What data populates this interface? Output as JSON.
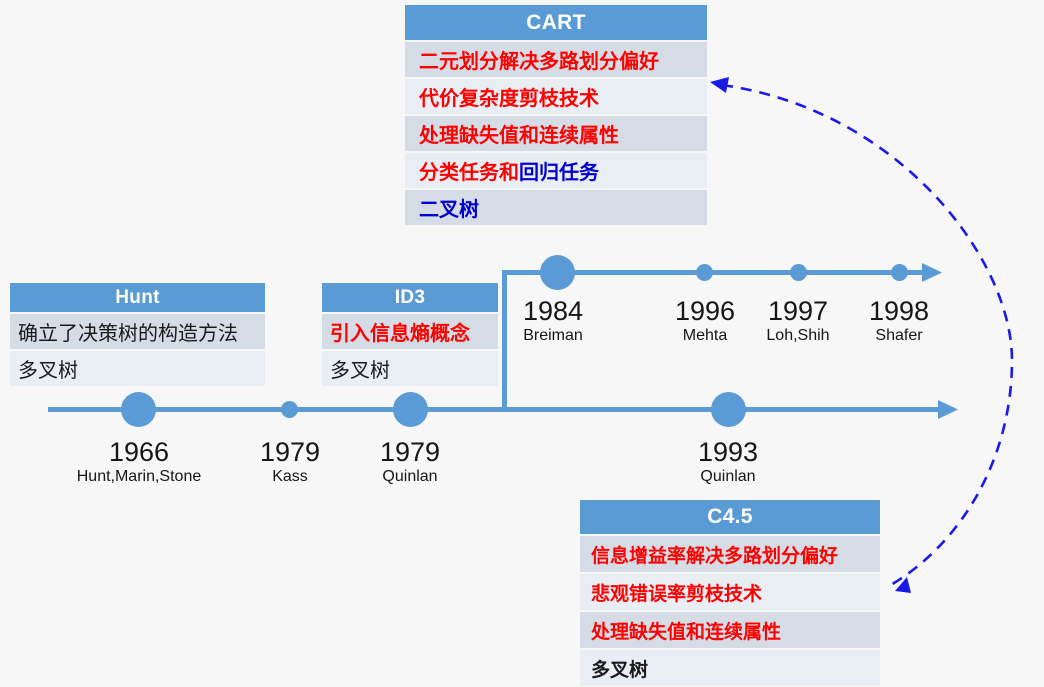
{
  "theme": {
    "background": "#F7F7F7",
    "accent_blue": "#5B9BD5",
    "row_dark": "#D6DCE5",
    "row_light": "#E9EDF4",
    "text_red": "#FF0000",
    "text_blue": "#0000CC",
    "text_dark": "#1A1A1A",
    "arrow_blue": "#1A1AE6"
  },
  "cards": {
    "cart": {
      "title": "CART",
      "rows": [
        {
          "parts": [
            {
              "text": "二元划分解决多路划分偏好",
              "color": "#FF0000"
            }
          ]
        },
        {
          "parts": [
            {
              "text": "代价复杂度剪枝技术",
              "color": "#FF0000"
            }
          ]
        },
        {
          "parts": [
            {
              "text": "处理缺失值和连续属性",
              "color": "#FF0000"
            }
          ]
        },
        {
          "parts": [
            {
              "text": "分类任务和",
              "color": "#FF0000"
            },
            {
              "text": "回归任务",
              "color": "#0000CC"
            }
          ]
        },
        {
          "parts": [
            {
              "text": "二叉树",
              "color": "#0000CC"
            }
          ]
        }
      ]
    },
    "c45": {
      "title": "C4.5",
      "rows": [
        {
          "parts": [
            {
              "text": "信息增益率解决多路划分偏好",
              "color": "#FF0000"
            }
          ]
        },
        {
          "parts": [
            {
              "text": "悲观错误率剪枝技术",
              "color": "#FF0000"
            }
          ]
        },
        {
          "parts": [
            {
              "text": "处理缺失值和连续属性",
              "color": "#FF0000"
            }
          ]
        },
        {
          "parts": [
            {
              "text": "多叉树",
              "color": "#1A1A1A"
            }
          ]
        }
      ]
    },
    "hunt": {
      "title": "Hunt",
      "rows": [
        {
          "parts": [
            {
              "text": "确立了决策树的构造方法",
              "color": "#1A1A1A"
            }
          ]
        },
        {
          "parts": [
            {
              "text": "多叉树",
              "color": "#1A1A1A"
            }
          ]
        }
      ]
    },
    "id3": {
      "title": "ID3",
      "rows": [
        {
          "parts": [
            {
              "text": "引入信息熵概念",
              "color": "#FF0000"
            }
          ]
        },
        {
          "parts": [
            {
              "text": "多叉树",
              "color": "#1A1A1A"
            }
          ]
        }
      ]
    }
  },
  "timelines": {
    "lower": {
      "ticks": [
        {
          "year": "1966",
          "who": "Hunt,Marin,Stone"
        },
        {
          "year": "1979",
          "who": "Kass"
        },
        {
          "year": "1979",
          "who": "Quinlan"
        },
        {
          "year": "1993",
          "who": "Quinlan"
        }
      ]
    },
    "upper": {
      "ticks": [
        {
          "year": "1984",
          "who": "Breiman"
        },
        {
          "year": "1996",
          "who": "Mehta"
        },
        {
          "year": "1997",
          "who": "Loh,Shih"
        },
        {
          "year": "1998",
          "who": "Shafer"
        }
      ]
    }
  }
}
